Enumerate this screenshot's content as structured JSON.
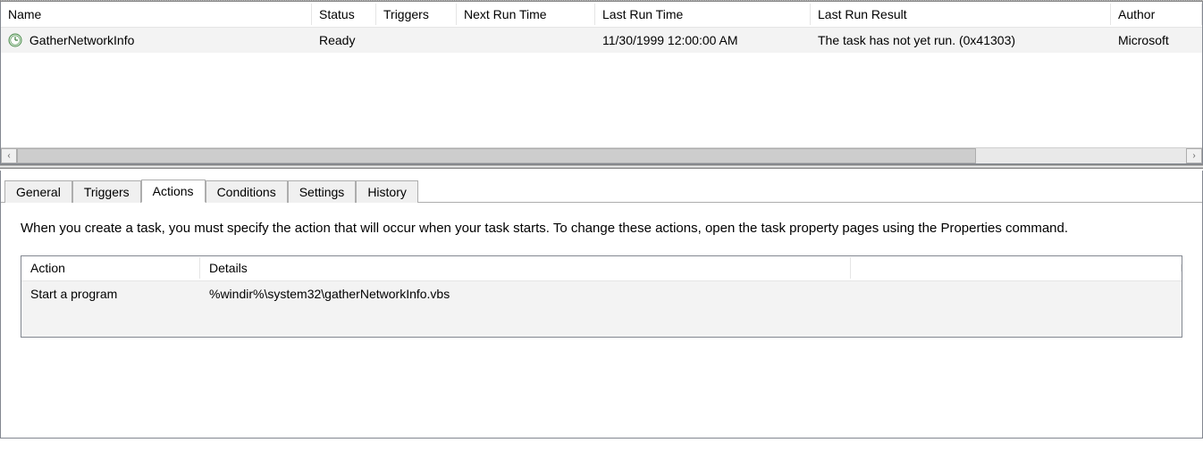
{
  "taskList": {
    "columns": {
      "name": "Name",
      "status": "Status",
      "triggers": "Triggers",
      "nextRun": "Next Run Time",
      "lastRun": "Last Run Time",
      "lastResult": "Last Run Result",
      "author": "Author"
    },
    "rows": [
      {
        "name": "GatherNetworkInfo",
        "status": "Ready",
        "triggers": "",
        "nextRun": "",
        "lastRun": "11/30/1999 12:00:00 AM",
        "lastResult": "The task has not yet run. (0x41303)",
        "author": "Microsoft"
      }
    ]
  },
  "tabs": {
    "general": "General",
    "triggers": "Triggers",
    "actions": "Actions",
    "conditions": "Conditions",
    "settings": "Settings",
    "history": "History",
    "active": "actions"
  },
  "actionsPane": {
    "description": "When you create a task, you must specify the action that will occur when your task starts.  To change these actions, open the task property pages using the Properties command.",
    "columns": {
      "action": "Action",
      "details": "Details"
    },
    "rows": [
      {
        "action": "Start a program",
        "details": "%windir%\\system32\\gatherNetworkInfo.vbs"
      }
    ]
  }
}
